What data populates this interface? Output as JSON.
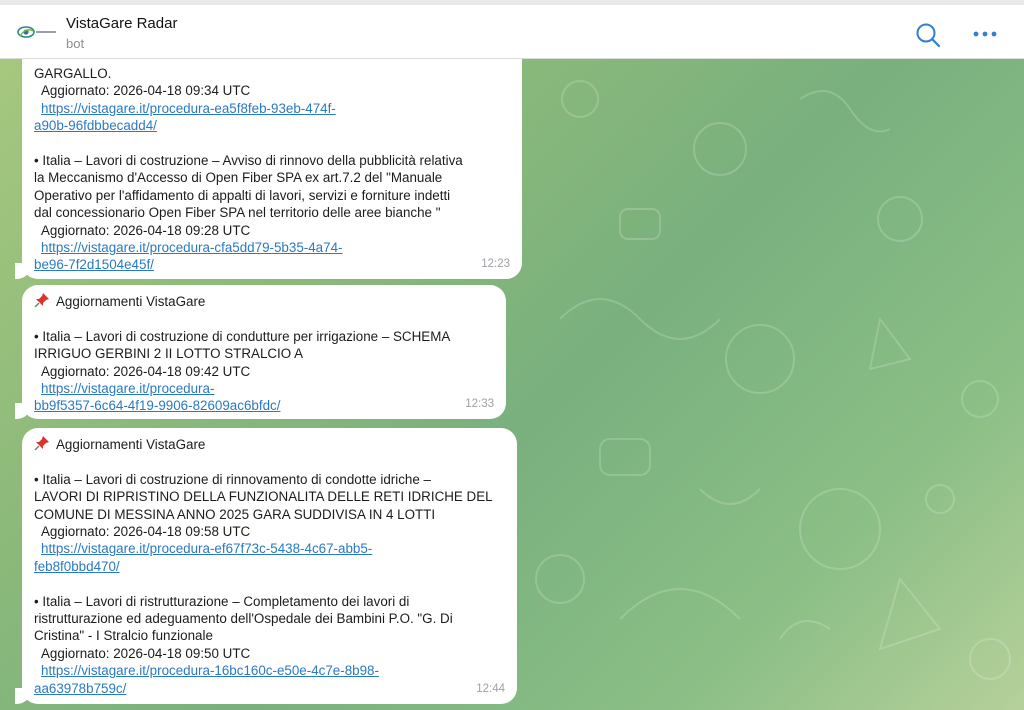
{
  "header": {
    "title": "VistaGare Radar",
    "subtitle": "bot",
    "avatar_icon": "vistagare-logo",
    "search_icon": "search-icon",
    "more_icon": "more-icon"
  },
  "colors": {
    "link": "#2a79c3",
    "accent": "#2a79c3",
    "bubble": "#ffffff",
    "chat_background": "#8dba7a"
  },
  "messages": [
    {
      "lines": [
        "GARGALLO.",
        "Aggiornato: 2026-04-18 09:34 UTC",
        "https://vistagare.it/procedura-ea5f8feb-93eb-474f-",
        "a90b-96fdbbecadd4/",
        "",
        "• Italia – Lavori di costruzione – Avviso di rinnovo della pubblicità relativa",
        "la Meccanismo d'Accesso di Open Fiber SPA ex art.7.2 del \"Manuale",
        "Operativo per l'affidamento di appalti di lavori, servizi e forniture indetti",
        "dal concessionario Open Fiber SPA nel territorio delle aree bianche \"",
        "Aggiornato: 2026-04-18 09:28 UTC",
        "https://vistagare.it/procedura-cfa5dd79-5b35-4a74-",
        "be96-7f2d1504e45f/"
      ],
      "time": "12:23"
    },
    {
      "header": "Aggiornamenti VistaGare",
      "lines": [
        "• Italia – Lavori di costruzione di condutture per irrigazione – SCHEMA",
        "IRRIGUO GERBINI 2 II LOTTO STRALCIO A",
        "Aggiornato: 2026-04-18 09:42 UTC",
        "https://vistagare.it/procedura-",
        "bb9f5357-6c64-4f19-9906-82609ac6bfdc/"
      ],
      "time": "12:33"
    },
    {
      "header": "Aggiornamenti VistaGare",
      "lines": [
        "• Italia – Lavori di costruzione di rinnovamento di condotte idriche –",
        "LAVORI DI RIPRISTINO DELLA FUNZIONALITA DELLE RETI IDRICHE DEL",
        "COMUNE DI MESSINA ANNO 2025 GARA SUDDIVISA IN 4 LOTTI",
        "Aggiornato: 2026-04-18 09:58 UTC",
        "https://vistagare.it/procedura-ef67f73c-5438-4c67-abb5-",
        "feb8f0bbd470/",
        "",
        "• Italia – Lavori di ristrutturazione – Completamento dei lavori di",
        "ristrutturazione ed adeguamento dell'Ospedale dei Bambini P.O. \"G. Di",
        "Cristina\" - I Stralcio funzionale",
        "Aggiornato: 2026-04-18 09:50 UTC",
        "https://vistagare.it/procedura-16bc160c-e50e-4c7e-8b98-",
        "aa63978b759c/"
      ],
      "time": "12:44"
    }
  ]
}
